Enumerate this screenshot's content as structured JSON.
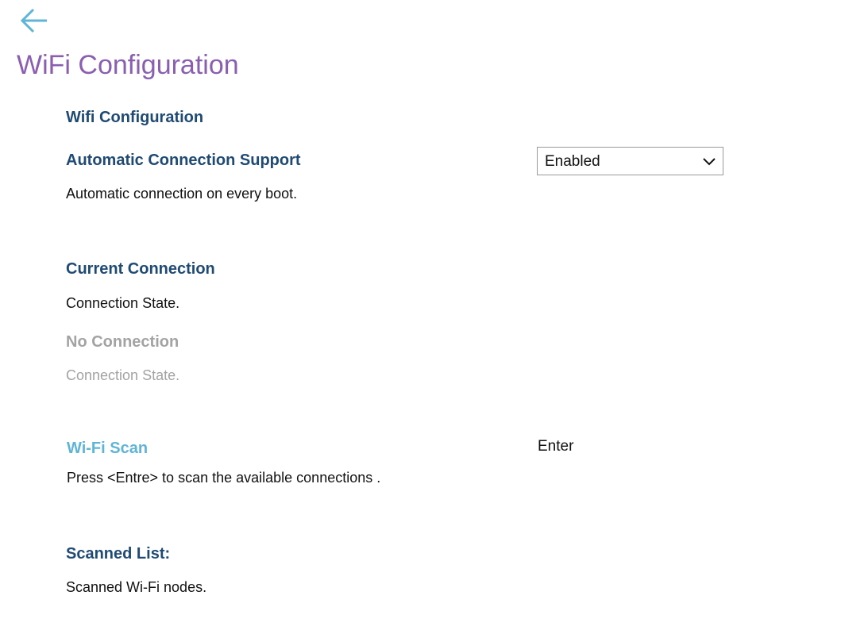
{
  "header": {
    "title": "WiFi Configuration",
    "back_icon": "arrow-left-icon",
    "accent_color": "#5fb5d6",
    "title_color": "#8a5fb0"
  },
  "sections": {
    "wifi_config": {
      "heading": "Wifi Configuration"
    },
    "auto_connect": {
      "heading": "Automatic Connection Support",
      "description": "Automatic connection on every boot.",
      "select_value": "Enabled",
      "select_icon": "chevron-down-icon"
    },
    "current_connection": {
      "heading": "Current Connection",
      "description": "Connection State.",
      "status_heading": "No Connection",
      "status_description": "Connection State."
    },
    "wifi_scan": {
      "heading": "Wi-Fi Scan",
      "description": "Press <Entre> to scan the available connections .",
      "action_label": "Enter"
    },
    "scanned_list": {
      "heading": "Scanned List:",
      "description": "Scanned Wi-Fi nodes."
    }
  }
}
